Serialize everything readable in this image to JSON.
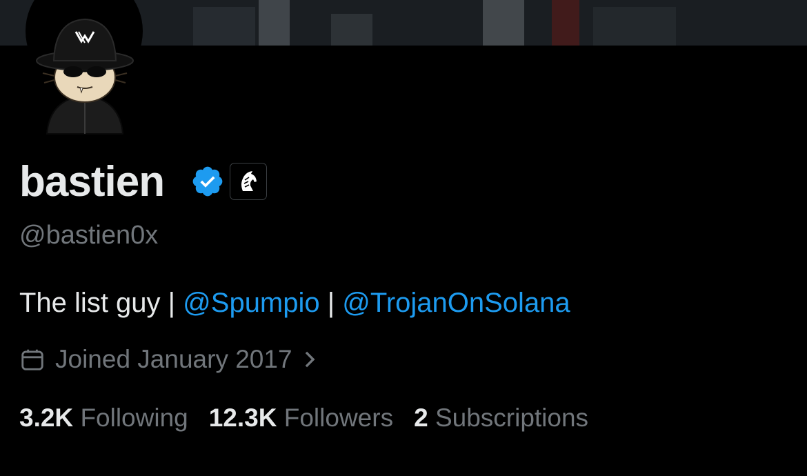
{
  "profile": {
    "display_name": "bastien",
    "handle": "@bastien0x",
    "bio": {
      "text": "The list guy | ",
      "separator": " | ",
      "links": [
        "@Spumpio",
        "@TrojanOnSolana"
      ]
    },
    "joined": "Joined January 2017",
    "stats": [
      {
        "value": "3.2K",
        "label": "Following"
      },
      {
        "value": "12.3K",
        "label": "Followers"
      },
      {
        "value": "2",
        "label": "Subscriptions"
      }
    ],
    "verified_color": "#1d9bf0",
    "link_color": "#1d9bf0"
  },
  "icons": {
    "verified": "verified-badge-icon",
    "affiliate": "horse-logo-icon",
    "calendar": "calendar-icon",
    "chevron": "chevron-right-icon",
    "avatar_logo": "v-logo-icon"
  }
}
